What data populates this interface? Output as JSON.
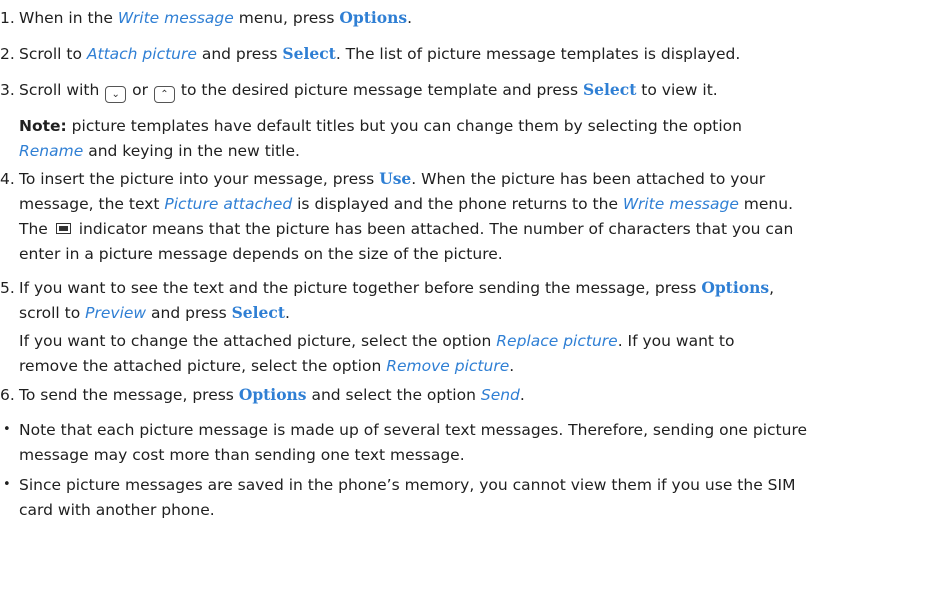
{
  "steps": [
    {
      "num": "1.",
      "lines": [
        [
          {
            "t": "When in the "
          },
          {
            "t": "Write message",
            "s": "i"
          },
          {
            "t": " menu, press "
          },
          {
            "t": "Options",
            "s": "b"
          },
          {
            "t": "."
          }
        ]
      ]
    },
    {
      "num": "2.",
      "lines": [
        [
          {
            "t": "Scroll to "
          },
          {
            "t": "Attach picture",
            "s": "i"
          },
          {
            "t": " and press "
          },
          {
            "t": "Select",
            "s": "b"
          },
          {
            "t": ". The list of picture message templates is displayed."
          }
        ]
      ]
    },
    {
      "num": "3.",
      "lines": [
        [
          {
            "t": " Scroll with "
          },
          {
            "k": "down"
          },
          {
            "t": " or "
          },
          {
            "k": "up"
          },
          {
            "t": " to the desired picture message template and press "
          },
          {
            "t": "Select",
            "s": "b"
          },
          {
            "t": " to view it."
          }
        ]
      ]
    },
    {
      "num": "",
      "lines": [
        [
          {
            "t": "Note:",
            "s": "n"
          },
          {
            "t": " picture templates have default titles but you can change them by selecting the option"
          }
        ],
        [
          {
            "t": "Rename",
            "s": "i"
          },
          {
            "t": " and keying in the new title."
          }
        ]
      ]
    },
    {
      "num": "4.",
      "lines": [
        [
          {
            "t": "To insert the picture into your message, press "
          },
          {
            "t": "Use",
            "s": "b"
          },
          {
            "t": ". When the picture has been attached to your"
          }
        ],
        [
          {
            "t": "message, the text "
          },
          {
            "t": "Picture attached",
            "s": "i"
          },
          {
            "t": " is displayed and the phone returns to the "
          },
          {
            "t": "Write message",
            "s": "i"
          },
          {
            "t": "  menu."
          }
        ],
        [
          {
            "t": "The "
          },
          {
            "k": "ind"
          },
          {
            "t": " indicator means that the picture has been attached. The number of characters that you can"
          }
        ],
        [
          {
            "t": "enter in a picture message depends on the size of the picture."
          }
        ]
      ]
    },
    {
      "num": "5.",
      "lines": [
        [
          {
            "t": " If you want to see the text and the picture together before sending the message, press "
          },
          {
            "t": "Options",
            "s": "b"
          },
          {
            "t": ","
          }
        ],
        [
          {
            "t": "scroll to "
          },
          {
            "t": "Preview",
            "s": "i"
          },
          {
            "t": " and press "
          },
          {
            "t": "Select",
            "s": "b"
          },
          {
            "t": "."
          }
        ]
      ]
    },
    {
      "num": "",
      "lines": [
        [
          {
            "t": "If you want to change the attached picture, select the option "
          },
          {
            "t": "Replace picture",
            "s": "i"
          },
          {
            "t": ". If you want to"
          }
        ],
        [
          {
            "t": "remove the attached picture, select the option "
          },
          {
            "t": "Remove picture",
            "s": "i"
          },
          {
            "t": "."
          }
        ]
      ]
    },
    {
      "num": "6.",
      "lines": [
        [
          {
            "t": "To send the message, press "
          },
          {
            "t": "Options",
            "s": "b"
          },
          {
            "t": " and select the option "
          },
          {
            "t": "Send",
            "s": "i"
          },
          {
            "t": "."
          }
        ]
      ]
    },
    {
      "num": "•",
      "lines": [
        [
          {
            "t": "Note that each picture message is made up of several text messages. Therefore, sending one picture"
          }
        ],
        [
          {
            "t": "message may cost more than sending one text message."
          }
        ]
      ]
    },
    {
      "num": "•",
      "lines": [
        [
          {
            "t": "Since picture messages are saved in the phone’s memory, you cannot view them if you use the SIM"
          }
        ],
        [
          {
            "t": "card with another phone."
          }
        ]
      ]
    }
  ],
  "icons": {
    "down": "scroll-down-key-icon",
    "up": "scroll-up-key-icon",
    "ind": "picture-attached-indicator-icon"
  }
}
